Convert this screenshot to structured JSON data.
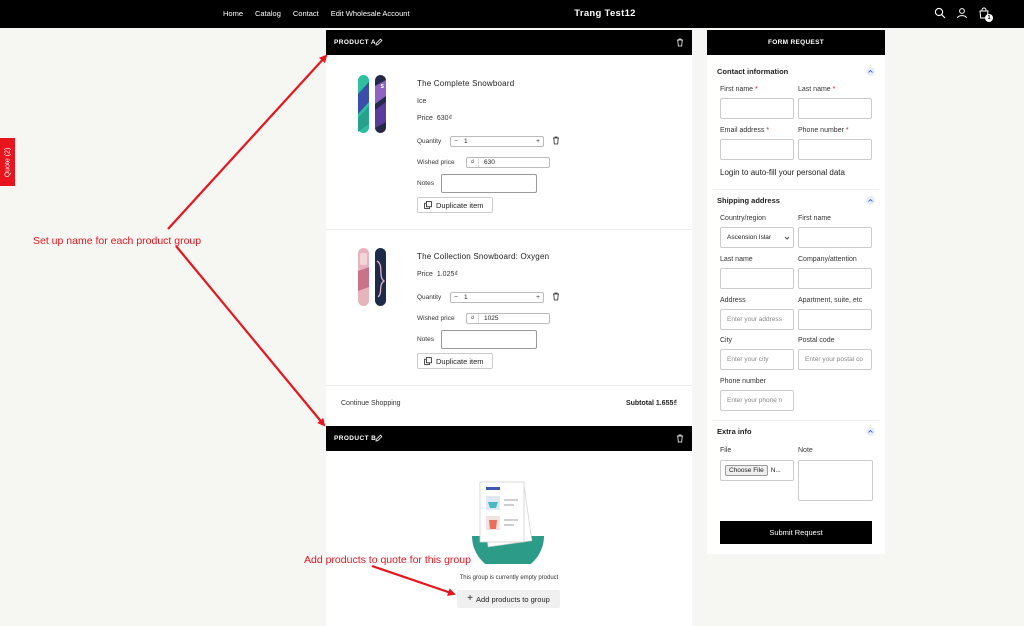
{
  "header": {
    "nav": [
      "Home",
      "Catalog",
      "Contact",
      "Edit Wholesale Account"
    ],
    "store_title": "Trang Test12",
    "cart_count": "1"
  },
  "quote_tab": "Quote (2)",
  "groups": [
    {
      "name": "PRODUCT A",
      "items": [
        {
          "name": "The Complete Snowboard",
          "variant": "Ice",
          "price_label": "Price",
          "price": "630₫",
          "quantity_label": "Quantity",
          "quantity": "1",
          "wished_label": "Wished price",
          "currency": "₫",
          "wished_price": "630",
          "notes_label": "Notes",
          "duplicate_label": "Duplicate item"
        },
        {
          "name": "The Collection Snowboard: Oxygen",
          "variant": "",
          "price_label": "Price",
          "price": "1.025₫",
          "quantity_label": "Quantity",
          "quantity": "1",
          "wished_label": "Wished price",
          "currency": "₫",
          "wished_price": "1025",
          "notes_label": "Notes",
          "duplicate_label": "Duplicate item"
        }
      ],
      "continue_label": "Continue Shopping",
      "subtotal": "Subtotal 1.655₫"
    },
    {
      "name": "PRODUCT B",
      "empty_text": "This group is currently empty product",
      "add_label": "Add products to group"
    }
  ],
  "form": {
    "title": "FORM REQUEST",
    "contact": {
      "title": "Contact information",
      "first_name": "First name",
      "last_name": "Last name",
      "email": "Email address",
      "phone": "Phone number",
      "login_text": "Login to auto-fill your personal data"
    },
    "shipping": {
      "title": "Shipping address",
      "country_label": "Country/region",
      "country_value": "Ascension Islar",
      "first_name": "First name",
      "last_name": "Last name",
      "company": "Company/attention",
      "address": "Address",
      "address_placeholder": "Enter your address",
      "apartment": "Apartment, suite, etc",
      "city": "City",
      "city_placeholder": "Enter your city",
      "postal": "Postal code",
      "postal_placeholder": "Enter your postal co",
      "phone": "Phone number",
      "phone_placeholder": "Enter your phone n"
    },
    "extra": {
      "title": "Extra info",
      "file_label": "File",
      "choose_file": "Choose File",
      "no_file": "N...",
      "note_label": "Note"
    },
    "submit": "Submit Request"
  },
  "annotations": {
    "group_name": "Set up name for each product group",
    "add_products": "Add products to quote for this group"
  },
  "colors": {
    "accent_red": "#e8141e",
    "header_black": "#000000",
    "page_bg": "#f6f6f3"
  }
}
